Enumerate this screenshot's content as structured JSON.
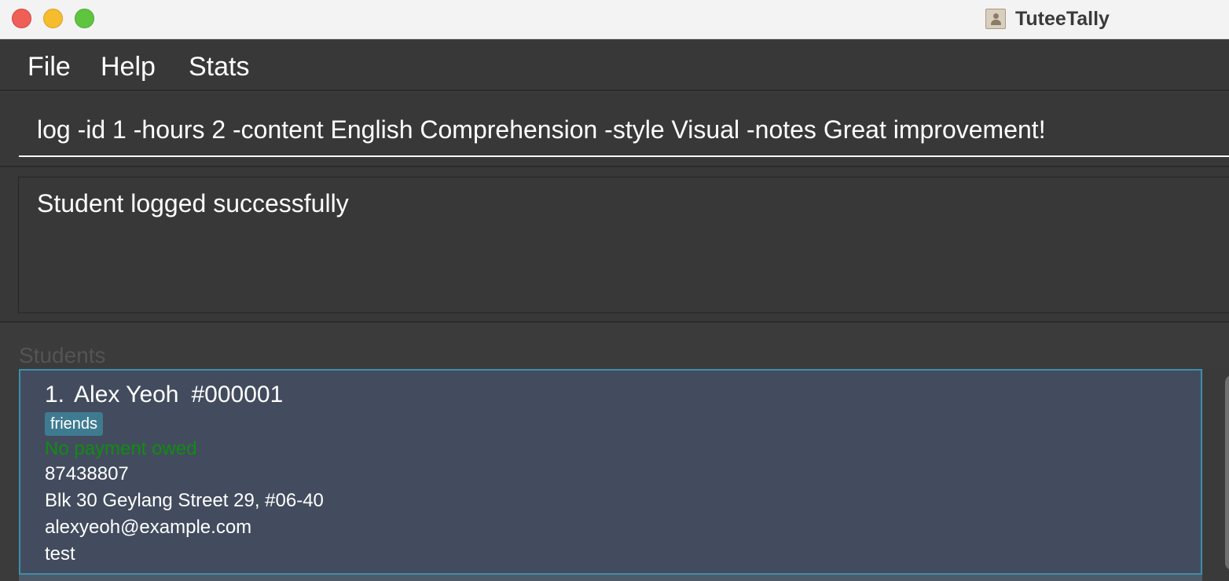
{
  "window": {
    "title": "TuteeTally",
    "app_icon": "contacts-book-icon"
  },
  "menu": {
    "file": "File",
    "help": "Help",
    "stats": "Stats"
  },
  "command": {
    "value": "log -id 1 -hours 2 -content English Comprehension -style Visual -notes Great improvement!"
  },
  "result": {
    "text": "Student logged successfully"
  },
  "students": {
    "title": "Students",
    "items": [
      {
        "index": "1.",
        "name": "Alex Yeoh",
        "id": "#000001",
        "tags": [
          "friends"
        ],
        "payment": "No payment owed",
        "phone": "87438807",
        "address": "Blk 30 Geylang Street 29, #06-40",
        "email": "alexyeoh@example.com",
        "note": "test"
      }
    ]
  },
  "colors": {
    "background": "#3b3b3b",
    "card_background": "#424c5e",
    "card_border": "#3d8eaa",
    "tag_background": "#3e7b91",
    "payment_ok": "#118c11"
  }
}
